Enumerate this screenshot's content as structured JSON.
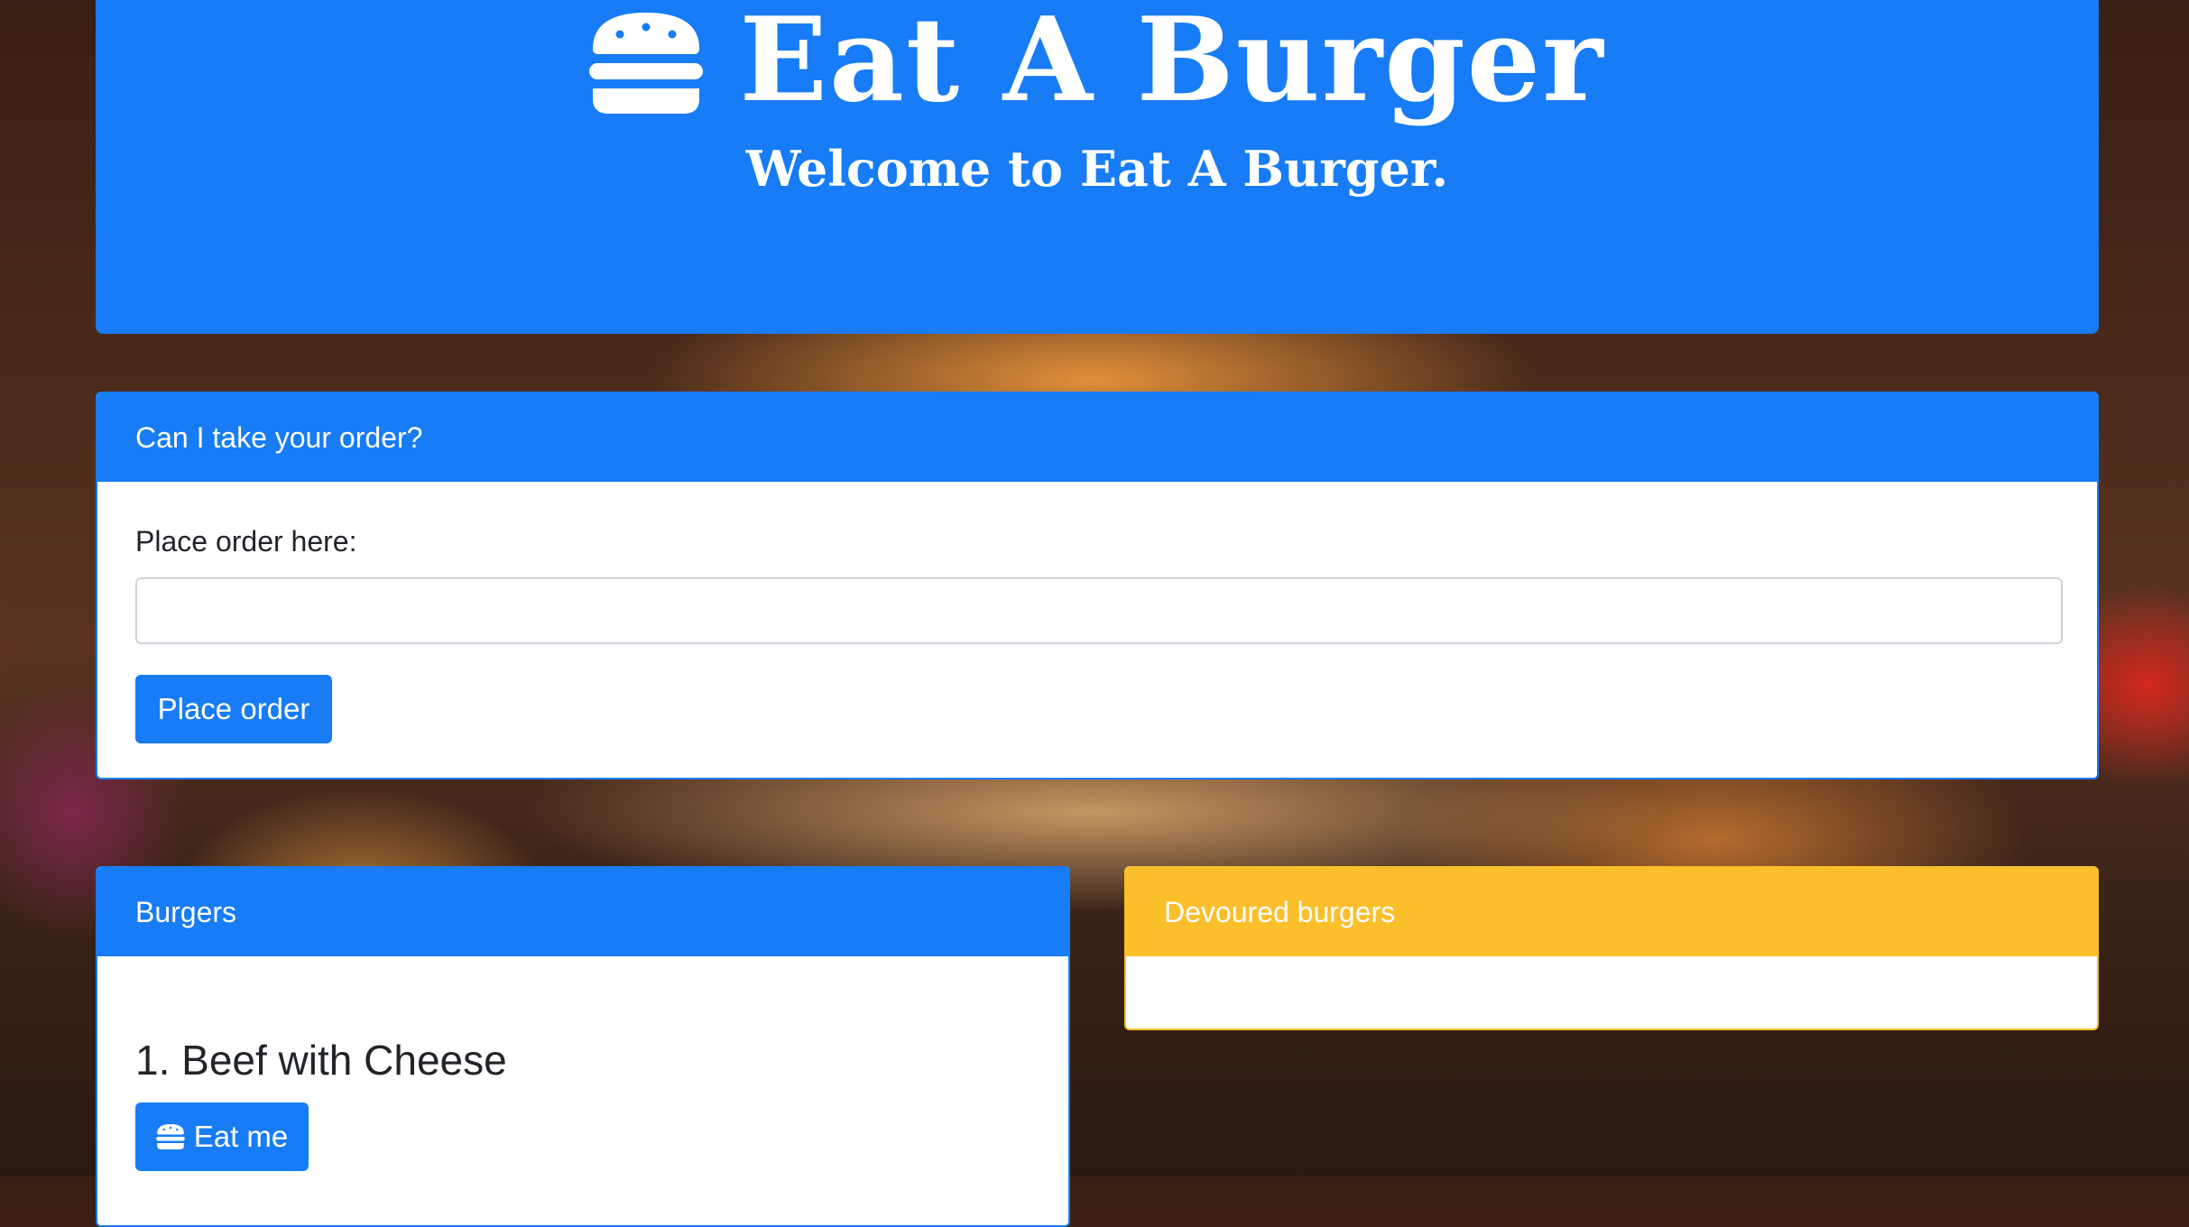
{
  "header": {
    "title": "Eat A Burger",
    "subtitle": "Welcome to Eat A Burger.",
    "icon": "burger-icon"
  },
  "order": {
    "header": "Can I take your order?",
    "label": "Place order here:",
    "input_value": "",
    "button_label": "Place order"
  },
  "burgers": {
    "header": "Burgers",
    "items": [
      {
        "title": "1. Beef with Cheese",
        "button_label": "Eat me",
        "button_icon": "burger-icon"
      }
    ]
  },
  "devoured": {
    "header": "Devoured burgers",
    "items": []
  },
  "colors": {
    "primary": "#177cf5",
    "warning": "#fbbf2c"
  }
}
